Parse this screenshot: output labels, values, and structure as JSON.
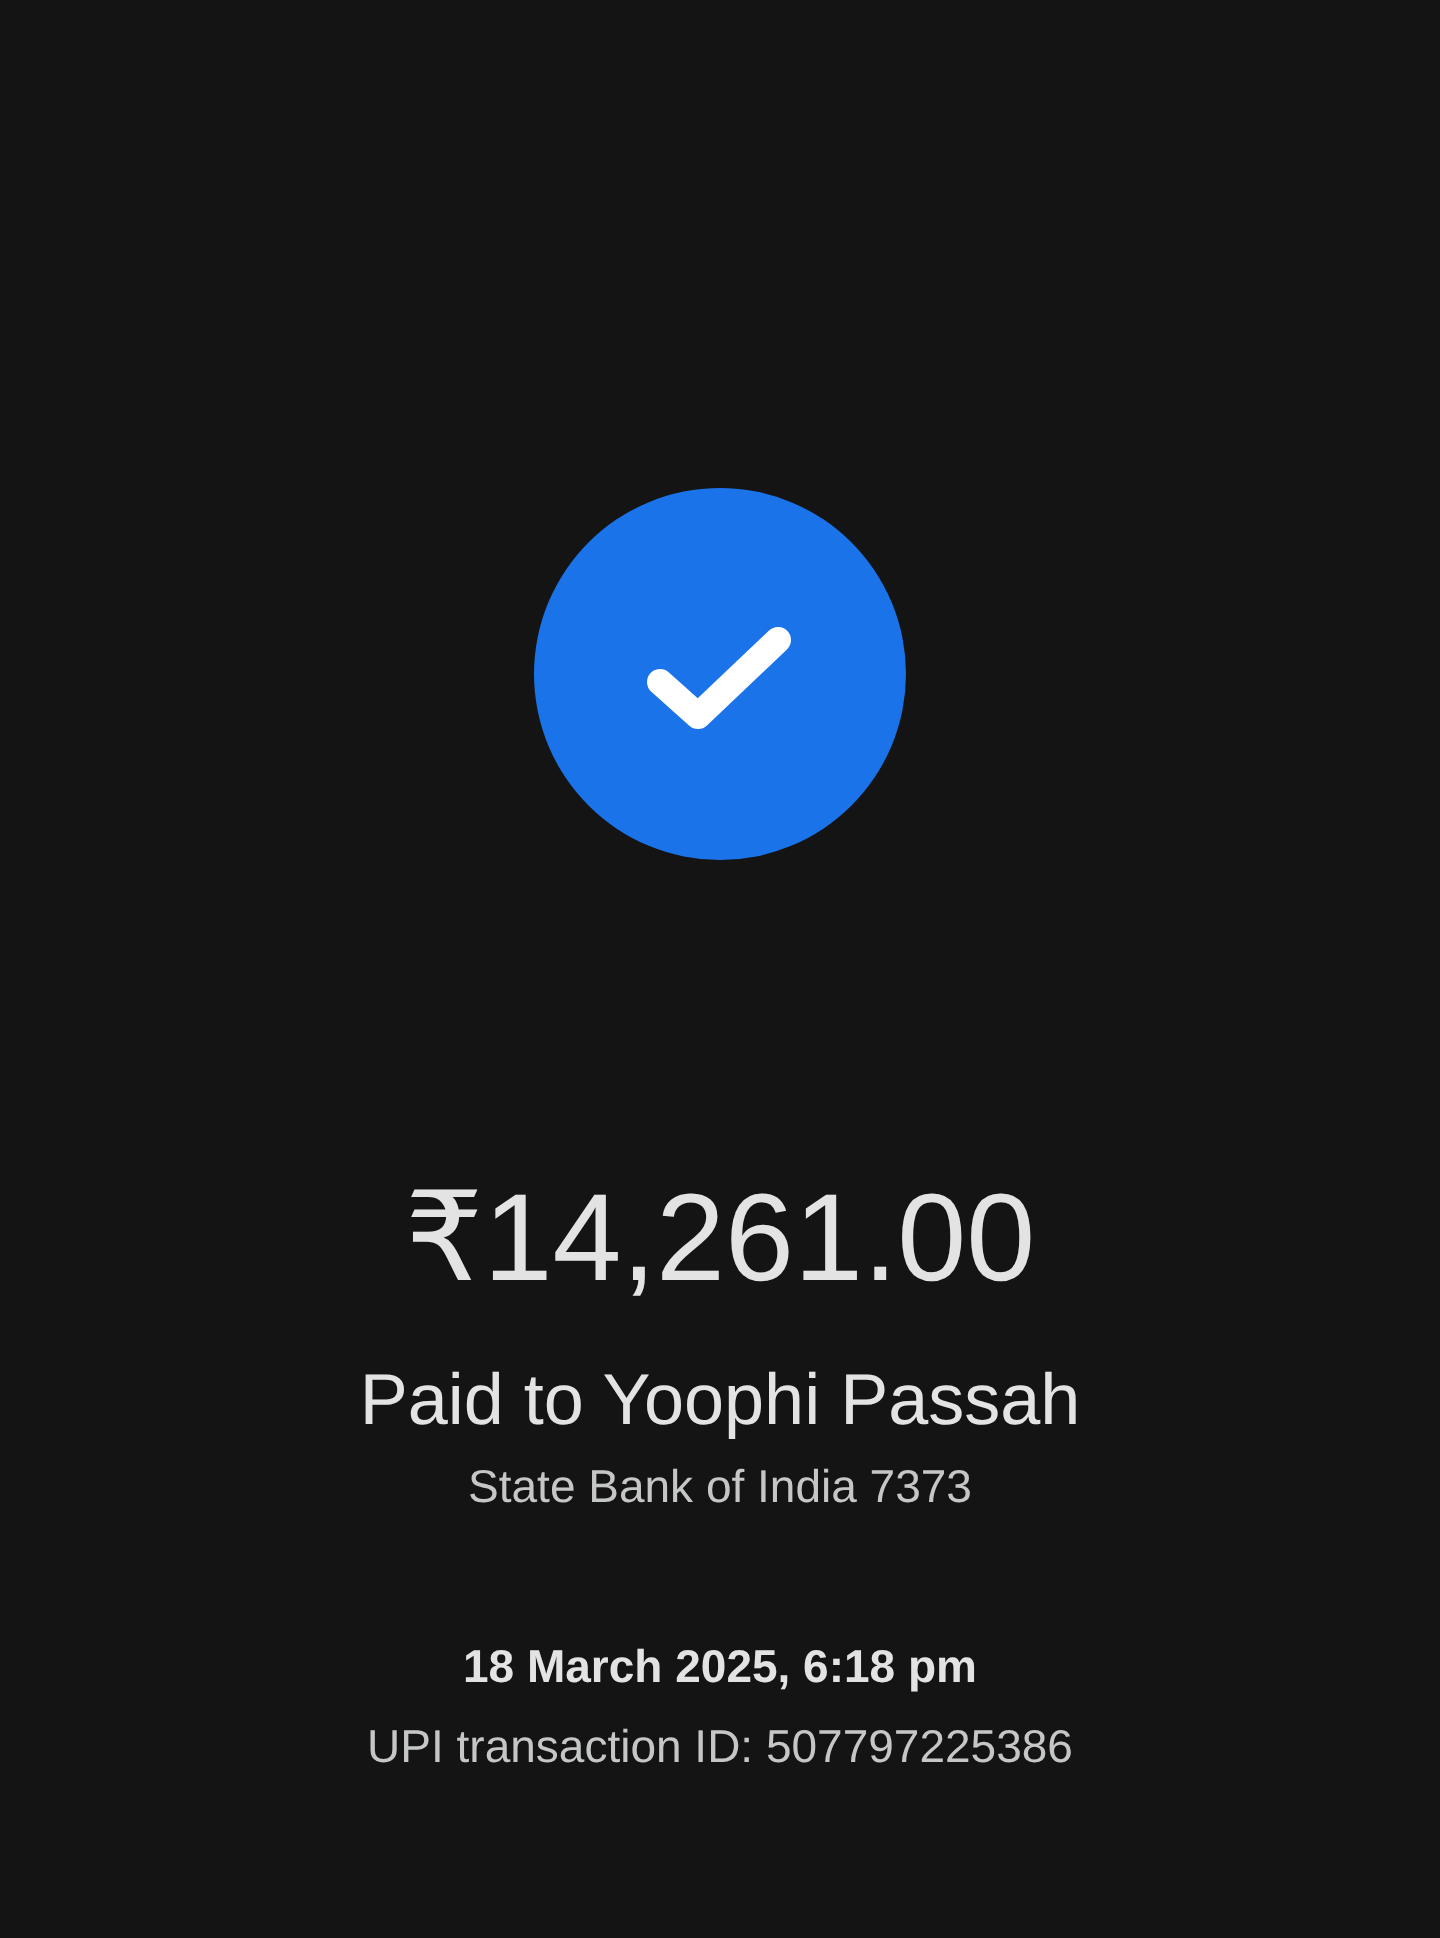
{
  "amount": "₹14,261.00",
  "recipient": "Paid to Yoophi Passah",
  "bank": "State Bank of India 7373",
  "datetime": "18 March 2025, 6:18 pm",
  "transaction_id": "UPI transaction ID: 507797225386"
}
